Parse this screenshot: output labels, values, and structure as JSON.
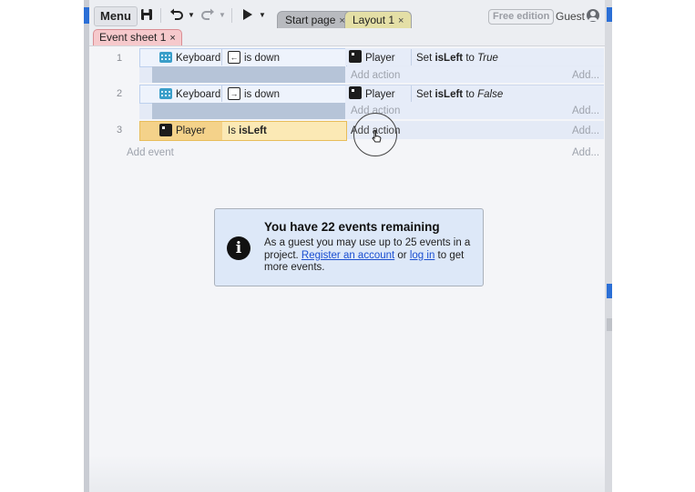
{
  "toolbar": {
    "menu_label": "Menu",
    "save_icon": "save-icon",
    "undo_icon": "undo-icon",
    "redo_icon": "redo-icon",
    "play_icon": "play-icon",
    "tabs": [
      {
        "label": "Start page",
        "close": "×"
      },
      {
        "label": "Layout 1",
        "close": "×"
      }
    ],
    "edition_badge": "Free edition",
    "user_label": "Guest"
  },
  "sheet_tab": {
    "label": "Event sheet 1",
    "close": "×"
  },
  "events": [
    {
      "number": "1",
      "condition": {
        "object": "Keyboard",
        "key_glyph": "←",
        "text": "is down"
      },
      "action": {
        "object": "Player",
        "text_prefix": "Set ",
        "var": "isLeft",
        "text_mid": " to ",
        "value": "True"
      },
      "add_action": "Add action",
      "add_right": "Add..."
    },
    {
      "number": "2",
      "condition": {
        "object": "Keyboard",
        "key_glyph": "→",
        "text": "is down"
      },
      "action": {
        "object": "Player",
        "text_prefix": "Set ",
        "var": "isLeft",
        "text_mid": " to ",
        "value": "False"
      },
      "add_action": "Add action",
      "add_right": "Add..."
    },
    {
      "number": "3",
      "condition": {
        "object": "Player",
        "text_prefix": "Is ",
        "var": "isLeft"
      },
      "add_action": "Add action",
      "add_right": "Add..."
    }
  ],
  "add_event": {
    "label": "Add event",
    "right": "Add..."
  },
  "info": {
    "icon": "info-icon",
    "title": "You have 22 events remaining",
    "body_1": "As a guest you may use up to 25 events in a project. ",
    "link_register": "Register an account",
    "body_2": " or ",
    "link_login": "log in",
    "body_3": " to get more events."
  },
  "colors": {
    "accent": "#2b6fd6",
    "selected_event": "#f4d28a",
    "event_bg": "#e4eaf6",
    "sheet_tab": "#f6c9cc",
    "layout_tab": "#e4dfa6",
    "link": "#1b4fd1"
  }
}
